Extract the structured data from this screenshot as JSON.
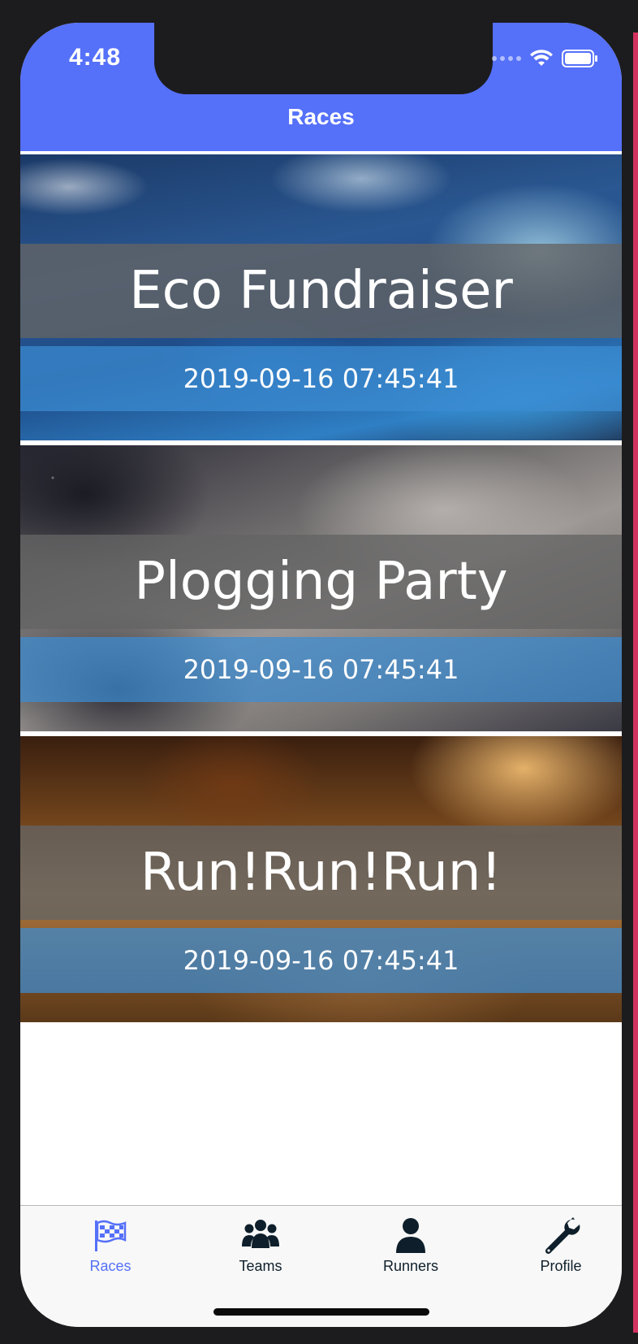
{
  "status_bar": {
    "time": "4:48"
  },
  "nav": {
    "title": "Races"
  },
  "races": [
    {
      "name": "Eco Fundraiser",
      "datetime": "2019-09-16 07:45:41",
      "background": "ocean-water-image"
    },
    {
      "name": "Plogging Party",
      "datetime": "2019-09-16 07:45:41",
      "background": "gravel-ground-image"
    },
    {
      "name": "Run!Run!Run!",
      "datetime": "2019-09-16 07:45:41",
      "background": "sunset-grass-field-image"
    }
  ],
  "tabbar": {
    "items": [
      {
        "label": "Races",
        "icon": "checkered-flag-icon",
        "active": true
      },
      {
        "label": "Teams",
        "icon": "group-people-icon",
        "active": false
      },
      {
        "label": "Runners",
        "icon": "person-icon",
        "active": false
      },
      {
        "label": "Profile",
        "icon": "wrench-icon",
        "active": false
      }
    ]
  },
  "colors": {
    "accent": "#5570f9",
    "tab_inactive": "#0e1f2b",
    "title_band": "#646464",
    "date_band": "#3c8cd2"
  }
}
